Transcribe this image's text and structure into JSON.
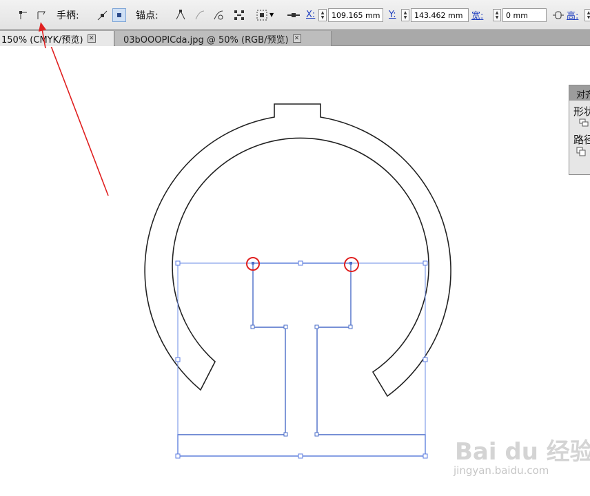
{
  "control_bar": {
    "handles_label": "手柄:",
    "anchors_label": "锚点:",
    "x_label": "X:",
    "x_value": "109.165 mm",
    "y_label": "Y:",
    "y_value": "143.462 mm",
    "width_label": "宽:",
    "width_value": "0 mm",
    "height_label": "高:"
  },
  "tabs": [
    {
      "label": "150% (CMYK/预览)",
      "close": "✕"
    },
    {
      "label": "03bOOOPICda.jpg @ 50% (RGB/预览)",
      "close": "✕"
    }
  ],
  "align_panel": {
    "title": "对齐",
    "shape_label": "形状",
    "path_label": "路径"
  },
  "watermark": {
    "brand": "Bai du 经验",
    "url": "jingyan.baidu.com"
  },
  "colors": {
    "selection": "#5b7be0",
    "annotation": "#e02020",
    "outline": "#222222"
  }
}
